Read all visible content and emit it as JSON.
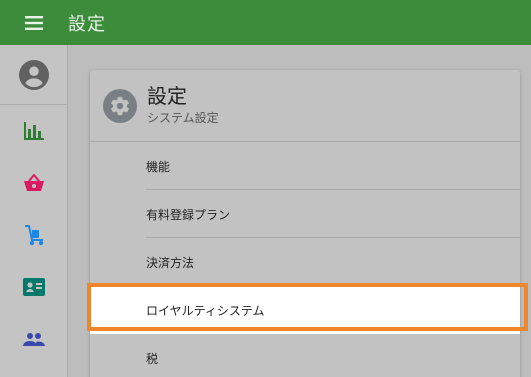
{
  "appbar": {
    "title": "設定",
    "menu_icon": "menu-icon"
  },
  "sidebar": {
    "items": [
      {
        "name": "account",
        "icon": "account-circle-icon",
        "color": "#616161"
      },
      {
        "name": "reports",
        "icon": "bar-chart-icon",
        "color": "#2e7d32"
      },
      {
        "name": "sales",
        "icon": "basket-icon",
        "color": "#d81b60"
      },
      {
        "name": "delivery",
        "icon": "hand-truck-icon",
        "color": "#1e88e5"
      },
      {
        "name": "customers",
        "icon": "id-card-icon",
        "color": "#00796b"
      },
      {
        "name": "staff",
        "icon": "people-icon",
        "color": "#3949ab"
      }
    ]
  },
  "card": {
    "title": "設定",
    "subtitle": "システム設定",
    "icon": "gear-icon",
    "items": [
      {
        "label": "機能"
      },
      {
        "label": "有料登録プラン"
      },
      {
        "label": "決済方法"
      },
      {
        "label": "ロイヤルティシステム",
        "selected": true
      },
      {
        "label": "税"
      }
    ]
  },
  "colors": {
    "appbar": "#3c8c3c",
    "highlight": "#f0862b"
  }
}
